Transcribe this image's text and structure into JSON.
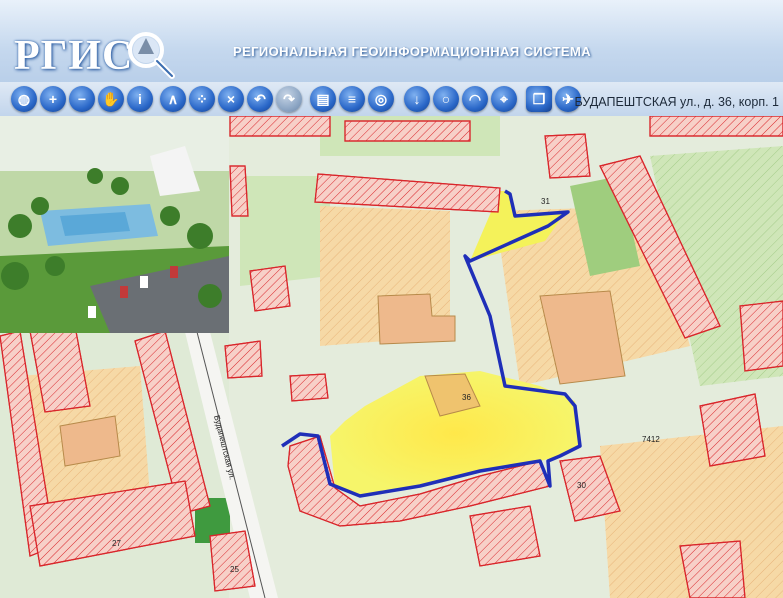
{
  "header": {
    "logo_text": "РГИС",
    "title": "РЕГИОНАЛЬНАЯ  ГЕОИНФОРМАЦИОННАЯ СИСТЕМА"
  },
  "toolbar": {
    "address": "БУДАПЕШТСКАЯ ул., д. 36, корп. 1"
  },
  "map": {
    "street_label": "Будапештская ул.",
    "labels": {
      "b31": "31",
      "b36": "36",
      "b7412": "7412",
      "b27": "27",
      "b25": "25",
      "b30": "30"
    }
  },
  "colors": {
    "selection": "#1f2fb8",
    "highlight": "#f4f25a",
    "building_outline": "#d9262b",
    "lot": "#f6d9a6",
    "green": "#cfe6b8"
  }
}
